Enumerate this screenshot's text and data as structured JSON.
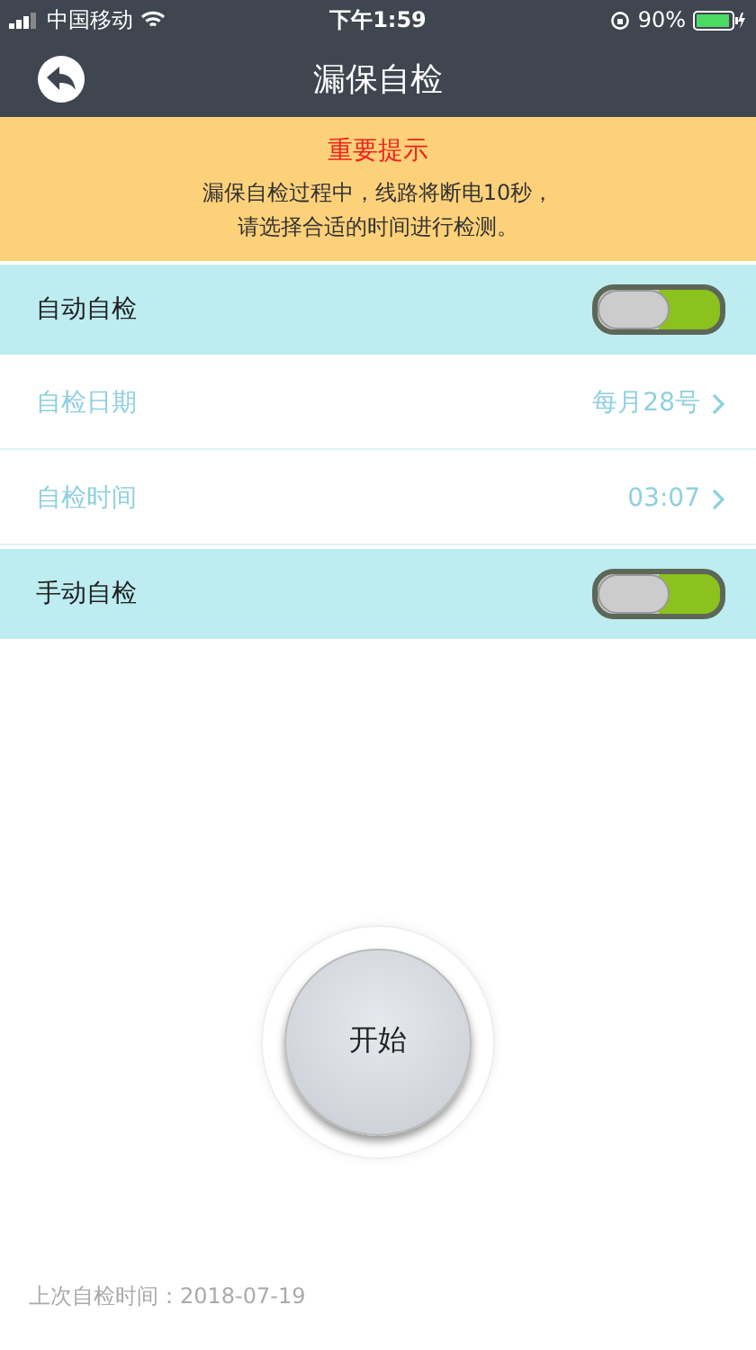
{
  "status_bar": {
    "carrier": "中国移动",
    "time": "下午1:59",
    "battery": "90%"
  },
  "nav_bar": {
    "title": "漏保自检"
  },
  "notice": {
    "title": "重要提示",
    "lines": [
      "漏保自检过程中，线路将断电10秒，",
      "请选择合适的时间进行检测。"
    ]
  },
  "settings": [
    {
      "kind": "toggle",
      "label": "自动自检",
      "on": true
    },
    {
      "kind": "value",
      "label": "自检日期",
      "value": "每月28号"
    },
    {
      "kind": "value",
      "label": "自检时间",
      "value": "03:07"
    },
    {
      "kind": "toggle",
      "label": "手动自检",
      "on": true
    }
  ],
  "start_button": {
    "label": "开始"
  },
  "footer": {
    "last_check": "上次自检时间：2018-07-19"
  }
}
